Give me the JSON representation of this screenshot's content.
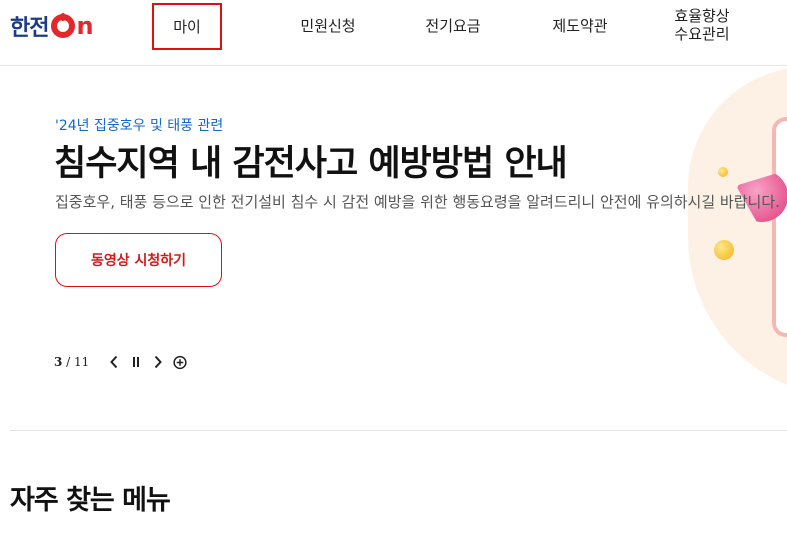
{
  "header": {
    "logo_text": "한전",
    "logo_on_text": "n",
    "nav": {
      "my": "마이",
      "civil": "민원신청",
      "bill": "전기요금",
      "terms": "제도약관",
      "eff_line1": "효율향상",
      "eff_line2": "수요관리"
    }
  },
  "hero": {
    "tag": "'24년 집중호우 및 태풍 관련",
    "title": "침수지역 내 감전사고 예방방법 안내",
    "description": "집중호우, 태풍 등으로 인한 전기설비 침수 시 감전 예방을 위한 행동요령을 알려드리니 안전에 유의하시길 바랍니다.",
    "button_label": "동영상 시청하기",
    "pager_current": "3",
    "pager_sep": " / ",
    "pager_total": "11"
  },
  "section": {
    "title": "자주 찾는 메뉴"
  },
  "colors": {
    "brand_blue": "#1b3c8a",
    "brand_red": "#e3272d",
    "tag_blue": "#1569c7",
    "highlight_box": "#e01010"
  },
  "icons": {
    "prev": "chevron-left-icon",
    "pause": "pause-icon",
    "next": "chevron-right-icon",
    "more": "plus-circle-icon"
  }
}
